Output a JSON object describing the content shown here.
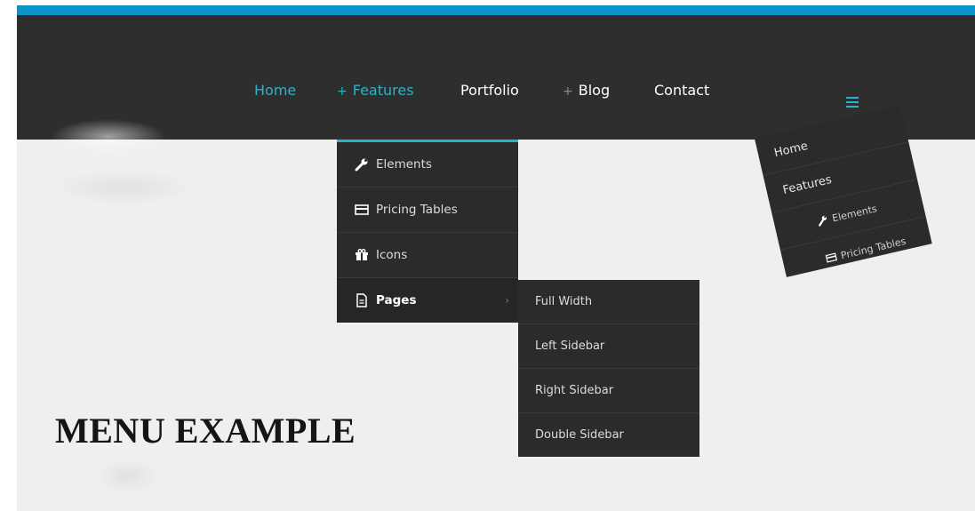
{
  "nav": {
    "items": [
      {
        "label": "Home",
        "has_plus": false,
        "active": true
      },
      {
        "label": "Features",
        "has_plus": true,
        "active": true
      },
      {
        "label": "Portfolio",
        "has_plus": false,
        "active": false
      },
      {
        "label": "Blog",
        "has_plus": true,
        "active": false
      },
      {
        "label": "Contact",
        "has_plus": false,
        "active": false
      }
    ],
    "plus_symbol": "+",
    "menu_icon": "hamburger-menu-icon"
  },
  "dropdown": {
    "items": [
      {
        "label": "Elements",
        "icon": "wrench-icon"
      },
      {
        "label": "Pricing Tables",
        "icon": "credit-card-icon"
      },
      {
        "label": "Icons",
        "icon": "gift-icon"
      },
      {
        "label": "Pages",
        "icon": "document-icon",
        "has_submenu": true
      }
    ],
    "chevron": "›"
  },
  "submenu": {
    "items": [
      "Full Width",
      "Left Sidebar",
      "Right Sidebar",
      "Double Sidebar"
    ]
  },
  "mobile_menu": {
    "items": [
      {
        "label": "Home"
      },
      {
        "label": "Features"
      },
      {
        "label": "Elements",
        "icon": "wrench-icon"
      },
      {
        "label": "Pricing Tables",
        "icon": "credit-card-icon"
      }
    ]
  },
  "headline": "MENU EXAMPLE",
  "colors": {
    "accent": "#29b3c8",
    "top_bar": "#0b94c9",
    "nav_bg": "#2e2e2e",
    "menu_bg": "#2b2b2b",
    "page_bg": "#efefef"
  }
}
